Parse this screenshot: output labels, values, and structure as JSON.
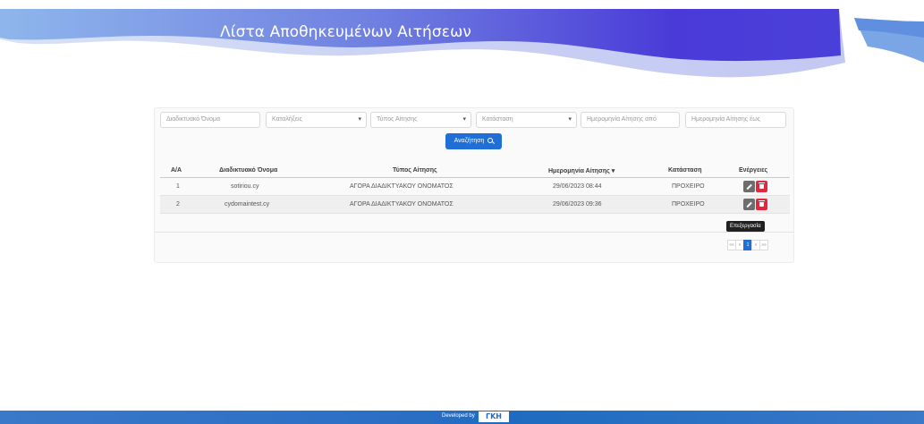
{
  "header": {
    "title": "Λίστα Αποθηκευμένων Αιτήσεων"
  },
  "filters": {
    "domain_name": "Διαδικτυακό Όνομα",
    "extension": "Καταλήξεις",
    "request_type": "Τύπος Αίτησης",
    "status": "Κατάσταση",
    "date_from": "Ημερομηνία Αίτησης από",
    "date_to": "Ημερομηνία Αίτησης έως"
  },
  "search_button": {
    "label": "Αναζήτηση"
  },
  "table": {
    "headers": {
      "index": "Α/Α",
      "domain": "Διαδικτυακό Όνομα",
      "type": "Τύπος Αίτησης",
      "date": "Ημερομηνία Αίτησης",
      "status": "Κατάσταση",
      "actions": "Ενέργειες"
    },
    "rows": [
      {
        "index": "1",
        "domain": "sotiriou.cy",
        "type": "ΑΓΟΡΑ ΔΙΑΔΙΚΤΥΑΚΟΥ ΟΝΟΜΑΤΟΣ",
        "date": "29/06/2023 08:44",
        "status": "ΠΡΟΧΕΙΡΟ"
      },
      {
        "index": "2",
        "domain": "cydomaintest.cy",
        "type": "ΑΓΟΡΑ ΔΙΑΔΙΚΤΥΑΚΟΥ ΟΝΟΜΑΤΟΣ",
        "date": "29/06/2023 09:36",
        "status": "ΠΡΟΧΕΙΡΟ"
      }
    ]
  },
  "tooltip": {
    "edit": "Επεξεργασία"
  },
  "pagination": {
    "first": "««",
    "prev": "«",
    "current": "1",
    "next": "»",
    "last": "»»"
  },
  "footer": {
    "developed_by": "Developed by",
    "logo_text": "ΓΚΗ"
  },
  "colors": {
    "primary": "#1f6fd6",
    "danger": "#e0283f",
    "footer": "#1e6bbf",
    "hero_dark": "#4a3bd8",
    "hero_light": "#7aa6e6"
  }
}
